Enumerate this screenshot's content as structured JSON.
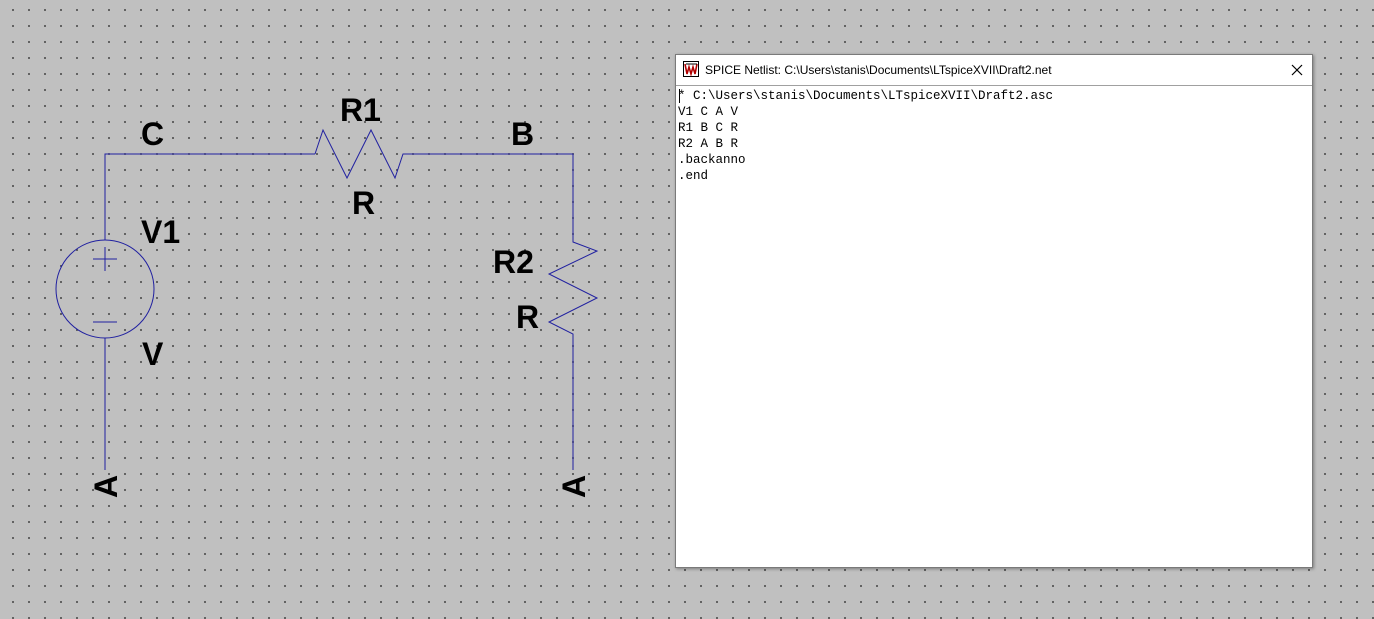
{
  "schematic": {
    "nets": {
      "c": "C",
      "b": "B",
      "ground_left": "A",
      "ground_right": "A"
    },
    "components": {
      "r1": {
        "name": "R1",
        "value": "R"
      },
      "r2": {
        "name": "R2",
        "value": "R"
      },
      "v1": {
        "name": "V1",
        "value": "V"
      }
    },
    "colors": {
      "wire": "#2020a0",
      "background": "#c0c0c0"
    }
  },
  "netlist_window": {
    "title": "SPICE Netlist: C:\\Users\\stanis\\Documents\\LTspiceXVII\\Draft2.net",
    "icon": "ltspice-app-icon",
    "close_icon": "close-icon",
    "lines": [
      "* C:\\Users\\stanis\\Documents\\LTspiceXVII\\Draft2.asc",
      "V1 C A V",
      "R1 B C R",
      "R2 A B R",
      ".backanno",
      ".end"
    ]
  }
}
